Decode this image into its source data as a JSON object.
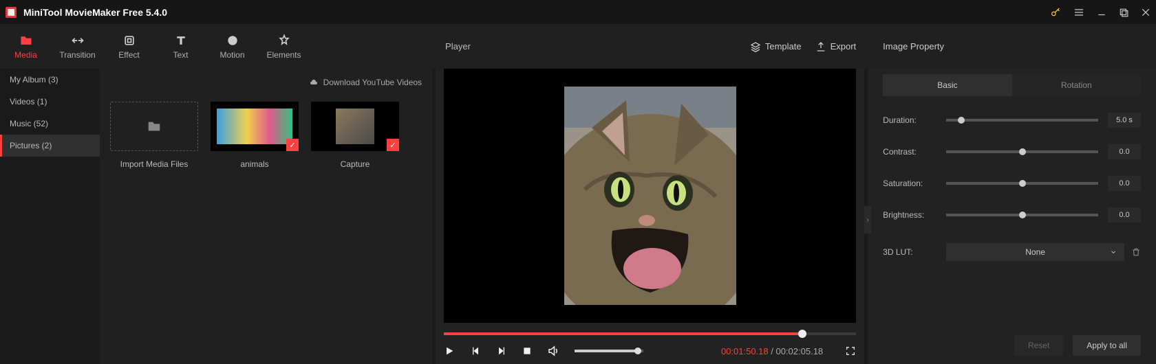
{
  "title": "MiniTool MovieMaker Free 5.4.0",
  "topTabs": [
    {
      "label": "Media"
    },
    {
      "label": "Transition"
    },
    {
      "label": "Effect"
    },
    {
      "label": "Text"
    },
    {
      "label": "Motion"
    },
    {
      "label": "Elements"
    }
  ],
  "sidebar": [
    {
      "label": "My Album (3)"
    },
    {
      "label": "Videos (1)"
    },
    {
      "label": "Music (52)"
    },
    {
      "label": "Pictures (2)"
    }
  ],
  "downloadLabel": "Download YouTube Videos",
  "mediaItems": [
    {
      "label": "Import Media Files"
    },
    {
      "label": "animals"
    },
    {
      "label": "Capture"
    }
  ],
  "player": {
    "title": "Player",
    "templateLabel": "Template",
    "exportLabel": "Export",
    "currentTime": "00:01:50.18",
    "totalTime": "00:02:05.18",
    "separator": " / "
  },
  "rightPanel": {
    "title": "Image Property",
    "tabBasic": "Basic",
    "tabRotation": "Rotation",
    "duration": {
      "label": "Duration:",
      "value": "5.0 s"
    },
    "contrast": {
      "label": "Contrast:",
      "value": "0.0"
    },
    "saturation": {
      "label": "Saturation:",
      "value": "0.0"
    },
    "brightness": {
      "label": "Brightness:",
      "value": "0.0"
    },
    "lut": {
      "label": "3D LUT:",
      "value": "None"
    },
    "resetLabel": "Reset",
    "applyLabel": "Apply to all"
  }
}
